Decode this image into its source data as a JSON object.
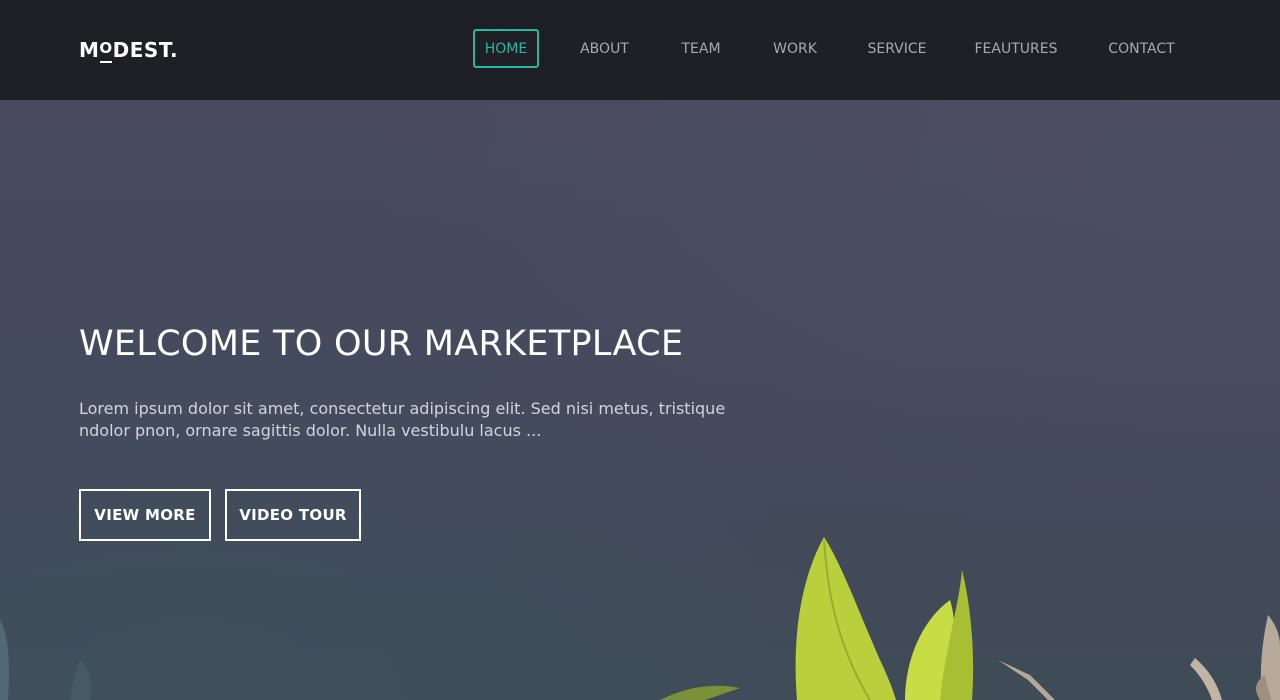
{
  "brand": {
    "logo_left": "M",
    "logo_o": "O",
    "logo_right": "DEST."
  },
  "nav": {
    "items": [
      {
        "label": "HOME",
        "active": true
      },
      {
        "label": "ABOUT"
      },
      {
        "label": "TEAM"
      },
      {
        "label": "WORK"
      },
      {
        "label": "SERVICE"
      },
      {
        "label": "FEAUTURES"
      },
      {
        "label": "CONTACT"
      }
    ],
    "accent_color": "#2ab6a2"
  },
  "hero": {
    "title": "WELCOME TO OUR MARKETPLACE",
    "text": "Lorem ipsum dolor sit amet, consectetur adipiscing elit. Sed nisi metus, tristique ndolor pnon, ornare sagittis dolor. Nulla vestibulu lacus ...",
    "buttons": {
      "view_more": "VIEW MORE",
      "video_tour": "VIDEO TOUR"
    }
  },
  "colors": {
    "navbar_bg": "#1e2025",
    "hero_overlay": "#454a5d",
    "leaf": "#c6d93f"
  }
}
